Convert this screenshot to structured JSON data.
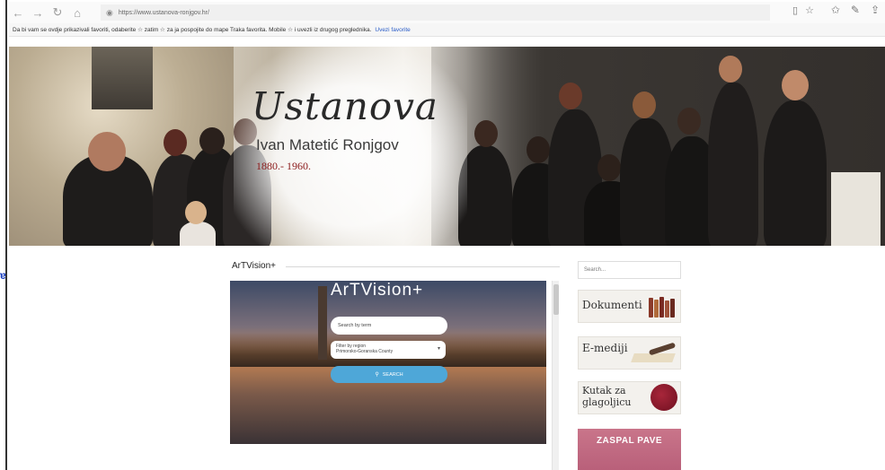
{
  "browser": {
    "url": "https://www.ustanova-ronjgov.hr/",
    "favorites_prompt": "Da bi vam se ovdje prikazivali favoriti, odaberite  ☆  zatim ☆ za ja pospojite do mape Traka favorita. Mobile ☆ i uvezli iz drugog preglednika.",
    "favorites_link": "Uvezi favorite"
  },
  "hero": {
    "title": "Ustanova",
    "subtitle": "Ivan Matetić Ronjgov",
    "years": "1880.- 1960."
  },
  "main": {
    "section_title": "ArTVision+",
    "panel_title": "ArTVision+",
    "search_placeholder": "Search by term",
    "region_label": "Filter by region",
    "region_value": "Primorsko-Goranska County",
    "search_button": "SEARCH"
  },
  "sidebar": {
    "search_placeholder": "Search...",
    "widgets": [
      {
        "label": "Dokumenti",
        "icon": "books-icon"
      },
      {
        "label": "E-mediji",
        "icon": "quill-icon"
      },
      {
        "label": "Kutak za glagoljicu",
        "line1": "Kutak za",
        "line2": "glagoljicu",
        "icon": "seal-icon"
      }
    ],
    "promo": "ZASPAL PAVE"
  },
  "colors": {
    "accent_red": "#8b1a1a",
    "button_blue": "#4ea7d8",
    "promo_pink": "#c9758a"
  }
}
